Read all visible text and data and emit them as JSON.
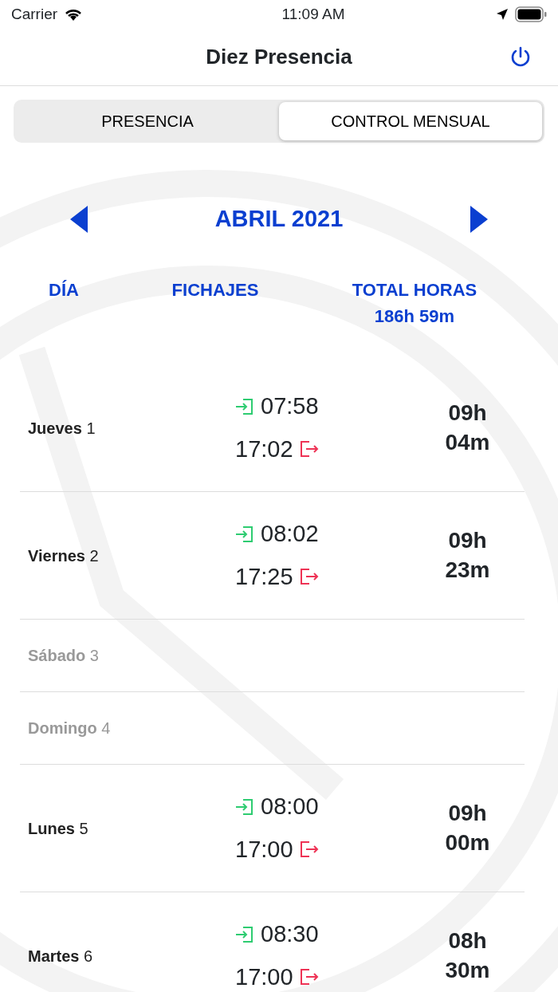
{
  "status_bar": {
    "carrier": "Carrier",
    "time": "11:09 AM"
  },
  "nav": {
    "title": "Diez Presencia"
  },
  "segments": [
    {
      "label": "PRESENCIA",
      "selected": false
    },
    {
      "label": "CONTROL MENSUAL",
      "selected": true
    }
  ],
  "month": {
    "label": "ABRIL 2021"
  },
  "columns": {
    "day": "DÍA",
    "punches": "FICHAJES",
    "total": "TOTAL HORAS",
    "total_value": "186h 59m"
  },
  "days": [
    {
      "day": "**Jueves** 1",
      "weekend": false,
      "in": "07:58",
      "out": "17:02",
      "hours": "09h",
      "minutes": "04m"
    },
    {
      "day": "**Viernes** 2",
      "weekend": false,
      "in": "08:02",
      "out": "17:25",
      "hours": "09h",
      "minutes": "23m"
    },
    {
      "day": "**Sábado** 3",
      "weekend": true
    },
    {
      "day": "**Domingo** 4",
      "weekend": true
    },
    {
      "day": "**Lunes** 5",
      "weekend": false,
      "in": "08:00",
      "out": "17:00",
      "hours": "09h",
      "minutes": "00m"
    },
    {
      "day": "**Martes** 6",
      "weekend": false,
      "in": "08:30",
      "out": "17:00",
      "hours": "08h",
      "minutes": "30m"
    }
  ]
}
